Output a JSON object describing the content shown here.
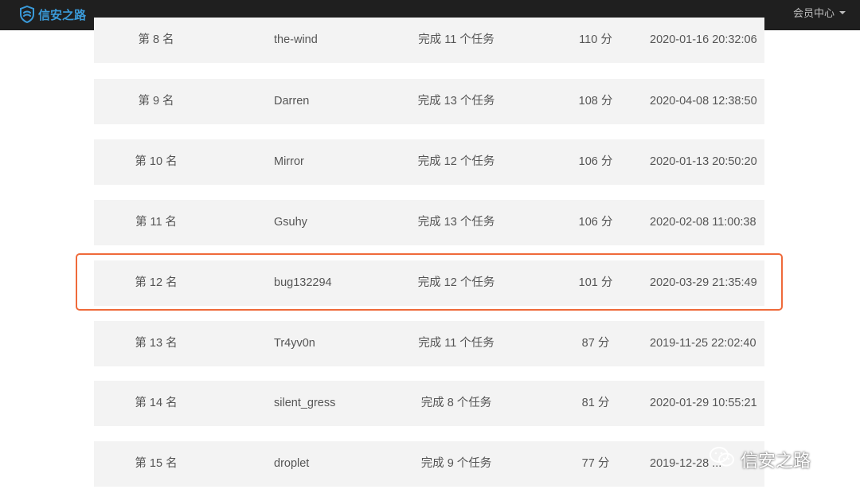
{
  "header": {
    "brand": "信安之路",
    "menu_label": "会员中心",
    "brand_color": "#3a9ad9",
    "background": "#1f1f1f"
  },
  "ranking": [
    {
      "rank": "第 8 名",
      "user": "the-wind",
      "tasks": "完成 11 个任务",
      "score": "110 分",
      "time": "2020-01-16 20:32:06"
    },
    {
      "rank": "第 9 名",
      "user": "Darren",
      "tasks": "完成 13 个任务",
      "score": "108 分",
      "time": "2020-04-08 12:38:50"
    },
    {
      "rank": "第 10 名",
      "user": "Mirror",
      "tasks": "完成 12 个任务",
      "score": "106 分",
      "time": "2020-01-13 20:50:20"
    },
    {
      "rank": "第 11 名",
      "user": "Gsuhy",
      "tasks": "完成 13 个任务",
      "score": "106 分",
      "time": "2020-02-08 11:00:38"
    },
    {
      "rank": "第 12 名",
      "user": "bug132294",
      "tasks": "完成 12 个任务",
      "score": "101 分",
      "time": "2020-03-29 21:35:49"
    },
    {
      "rank": "第 13 名",
      "user": "Tr4yv0n",
      "tasks": "完成 11 个任务",
      "score": "87 分",
      "time": "2019-11-25 22:02:40"
    },
    {
      "rank": "第 14 名",
      "user": "silent_gress",
      "tasks": "完成 8 个任务",
      "score": "81 分",
      "time": "2020-01-29 10:55:21"
    },
    {
      "rank": "第 15 名",
      "user": "droplet",
      "tasks": "完成 9 个任务",
      "score": "77 分",
      "time": "2019-12-28 ..."
    }
  ],
  "highlight": {
    "row_index": 4,
    "color": "#ef6a3a"
  },
  "watermark": {
    "text": "信安之路",
    "icon": "wechat-icon"
  }
}
